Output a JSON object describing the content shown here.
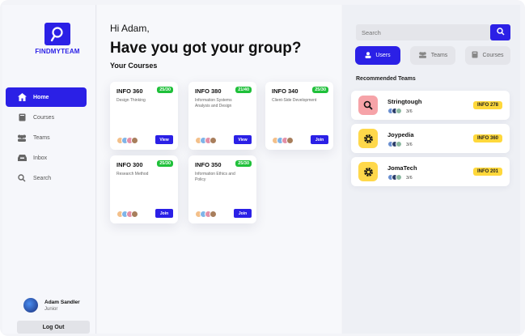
{
  "brand": {
    "name": "FINDMYTEAM",
    "color": "#2b20e6"
  },
  "sidebar": {
    "items": [
      {
        "label": "Home",
        "icon": "home-icon",
        "active": true
      },
      {
        "label": "Courses",
        "icon": "book-icon",
        "active": false
      },
      {
        "label": "Teams",
        "icon": "people-icon",
        "active": false
      },
      {
        "label": "Inbox",
        "icon": "inbox-icon",
        "active": false
      },
      {
        "label": "Search",
        "icon": "search-icon",
        "active": false
      }
    ],
    "user": {
      "name": "Adam Sandler",
      "role": "Junior"
    },
    "logout_label": "Log Out"
  },
  "main": {
    "greeting": "Hi Adam,",
    "headline": "Have you got your group?",
    "section_title": "Your Courses",
    "courses": [
      {
        "code": "INFO 360",
        "badge": "25/30",
        "desc": "Design Thinking",
        "button": "View"
      },
      {
        "code": "INFO 380",
        "badge": "21/40",
        "desc": "Information Systems Analysis and Design",
        "button": "View"
      },
      {
        "code": "INFO 340",
        "badge": "25/30",
        "desc": "Client-Side Development",
        "button": "Join"
      },
      {
        "code": "INFO 300",
        "badge": "25/30",
        "desc": "Research Method",
        "button": "Join"
      },
      {
        "code": "INFO 350",
        "badge": "25/30",
        "desc": "Information Ethics and Policy",
        "button": "Join"
      }
    ]
  },
  "right": {
    "search_placeholder": "Search",
    "tabs": [
      {
        "label": "Users",
        "icon": "user-icon",
        "active": true
      },
      {
        "label": "Teams",
        "icon": "people-icon",
        "active": false
      },
      {
        "label": "Courses",
        "icon": "book-icon",
        "active": false
      }
    ],
    "recommended_title": "Recommended Teams",
    "teams": [
      {
        "name": "Stringtough",
        "members": "3/6",
        "course": "INFO 278",
        "icon": "search-icon",
        "icon_bg": "#f6a3a8"
      },
      {
        "name": "Joypedia",
        "members": "3/6",
        "course": "INFO 360",
        "icon": "gear-icon",
        "icon_bg": "#ffd84a"
      },
      {
        "name": "JomaTech",
        "members": "3/6",
        "course": "INFO 201",
        "icon": "gear-icon",
        "icon_bg": "#ffd84a"
      }
    ]
  },
  "colors": {
    "accent": "#2b20e6",
    "badge_green": "#1fc03a",
    "tag_yellow": "#ffd83b"
  }
}
